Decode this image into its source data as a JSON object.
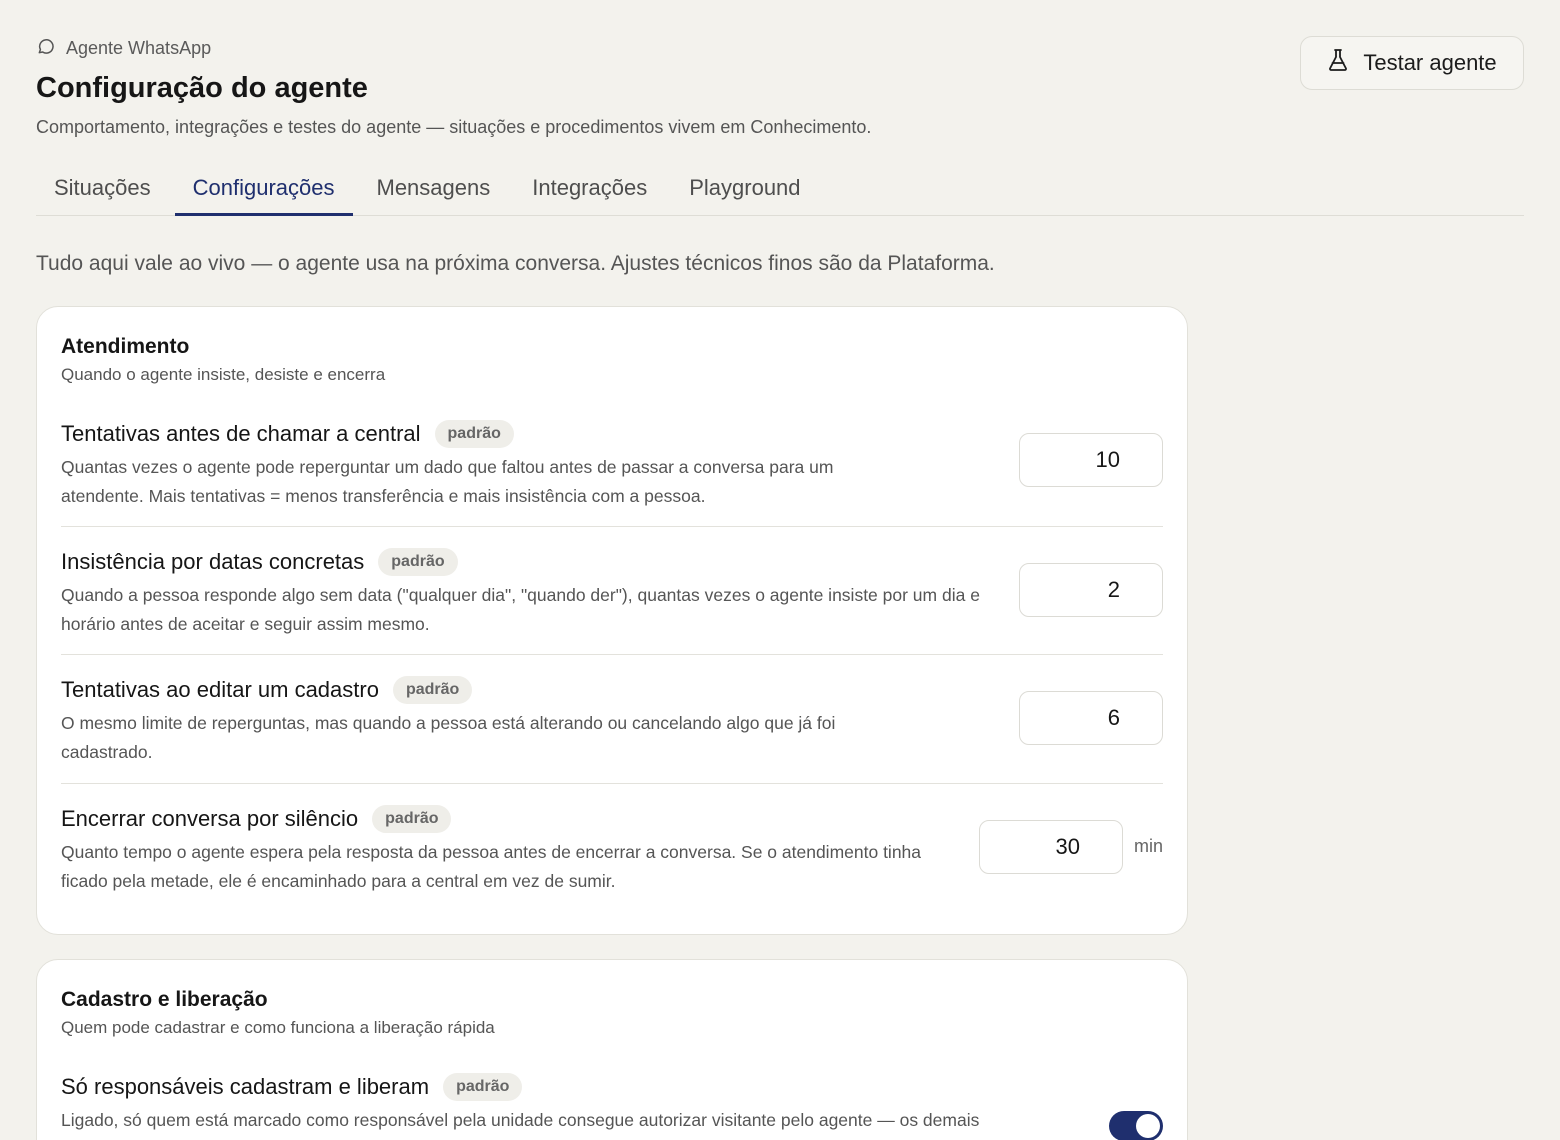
{
  "header": {
    "breadcrumb": "Agente WhatsApp",
    "breadcrumb_icon": "chat-bubble-icon",
    "title": "Configuração do agente",
    "subtitle": "Comportamento, integrações e testes do agente — situações e procedimentos vivem em Conhecimento.",
    "test_button": "Testar agente",
    "test_button_icon": "flask-icon"
  },
  "tabs": [
    {
      "label": "Situações",
      "active": false
    },
    {
      "label": "Configurações",
      "active": true
    },
    {
      "label": "Mensagens",
      "active": false
    },
    {
      "label": "Integrações",
      "active": false
    },
    {
      "label": "Playground",
      "active": false
    }
  ],
  "intro": "Tudo aqui vale ao vivo — o agente usa na próxima conversa. Ajustes técnicos finos são da Plataforma.",
  "cards": [
    {
      "title": "Atendimento",
      "subtitle": "Quando o agente insiste, desiste e encerra",
      "settings": [
        {
          "label": "Tentativas antes de chamar a central",
          "badge": "padrão",
          "description": "Quantas vezes o agente pode reperguntar um dado que faltou antes de passar a conversa para um atendente. Mais tentativas = menos transferência e mais insistência com a pessoa.",
          "value": "10"
        },
        {
          "label": "Insistência por datas concretas",
          "badge": "padrão",
          "description": "Quando a pessoa responde algo sem data (\"qualquer dia\", \"quando der\"), quantas vezes o agente insiste por um dia e horário antes de aceitar e seguir assim mesmo.",
          "value": "2"
        },
        {
          "label": "Tentativas ao editar um cadastro",
          "badge": "padrão",
          "description": "O mesmo limite de reperguntas, mas quando a pessoa está alterando ou cancelando algo que já foi cadastrado.",
          "value": "6"
        },
        {
          "label": "Encerrar conversa por silêncio",
          "badge": "padrão",
          "description": "Quanto tempo o agente espera pela resposta da pessoa antes de encerrar a conversa. Se o atendimento tinha ficado pela metade, ele é encaminhado para a central em vez de sumir.",
          "value": "30",
          "unit": "min"
        }
      ]
    },
    {
      "title": "Cadastro e liberação",
      "subtitle": "Quem pode cadastrar e como funciona a liberação rápida",
      "settings": [
        {
          "label": "Só responsáveis cadastram e liberam",
          "badge": "padrão",
          "description": "Ligado, só quem está marcado como responsável pela unidade consegue autorizar visitante pelo agente — os demais",
          "toggle_on": true
        }
      ]
    }
  ]
}
